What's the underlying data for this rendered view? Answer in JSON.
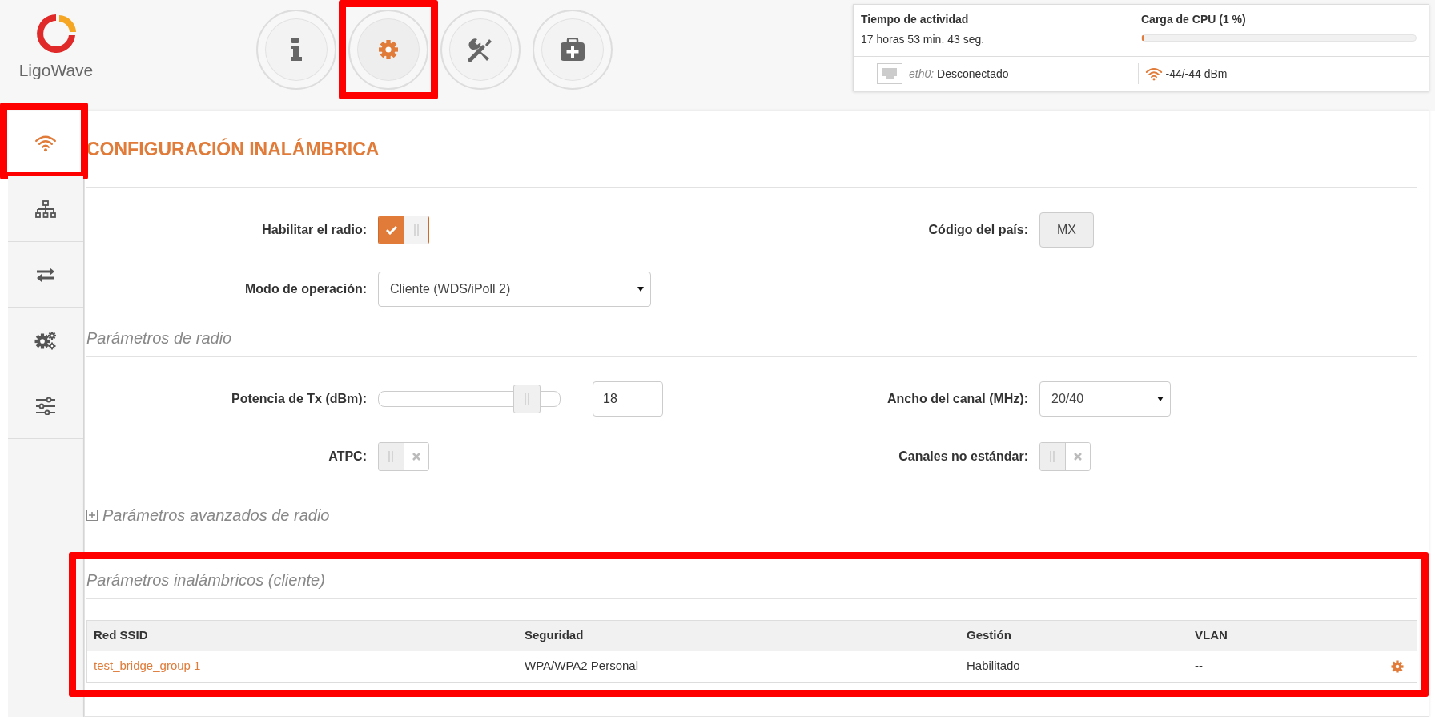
{
  "logo": {
    "text": "LigoWave"
  },
  "nav": [
    {
      "kind": "info",
      "selected": false,
      "highlighted": false
    },
    {
      "kind": "gear",
      "selected": true,
      "highlighted": true
    },
    {
      "kind": "tools",
      "selected": false,
      "highlighted": false
    },
    {
      "kind": "medkit",
      "selected": false,
      "highlighted": false
    }
  ],
  "status": {
    "uptime_label": "Tiempo de actividad",
    "uptime": "17 horas 53 min. 43 seg.",
    "cpu_label": "Carga de CPU (1 %)",
    "cpu_level": {
      "level": 0.01
    },
    "eth_name": "eth0:",
    "eth_status": "Desconectado",
    "signal": "-44/-44 dBm"
  },
  "sidebar": {
    "items": [
      {
        "kind": "wifi",
        "selected": true,
        "highlighted": true
      },
      {
        "kind": "network",
        "selected": false,
        "highlighted": false
      },
      {
        "kind": "arrows",
        "selected": false,
        "highlighted": false
      },
      {
        "kind": "gears",
        "selected": false,
        "highlighted": false
      },
      {
        "kind": "sliders",
        "selected": false,
        "highlighted": false
      }
    ]
  },
  "title": "CONFIGURACIÓN INALÁMBRICA",
  "general": {
    "rows": [
      {
        "left": {
          "kind": "toggle",
          "label": "Habilitar el radio:",
          "on": true
        },
        "right": {
          "kind": "readonly",
          "label": "Código del país:",
          "value": "MX"
        }
      },
      {
        "left": {
          "kind": "select",
          "label": "Modo de operación:",
          "value": "Cliente (WDS/iPoll 2)"
        }
      }
    ]
  },
  "radio_section": {
    "title": "Parámetros de radio",
    "rows": [
      {
        "left": {
          "kind": "slider",
          "label": "Potencia de Tx (dBm):",
          "level": 0.82,
          "value": "18"
        },
        "right": {
          "kind": "select",
          "label": "Ancho del canal (MHz):",
          "value": "20/40"
        }
      },
      {
        "left": {
          "kind": "toggle",
          "label": "ATPC:",
          "on": false
        },
        "right": {
          "kind": "toggle",
          "label": "Canales no estándar:",
          "on": false
        }
      }
    ]
  },
  "advanced": {
    "title": "Parámetros avanzados de radio",
    "expanded": false
  },
  "wireless": {
    "title": "Parámetros inalámbricos (cliente)",
    "highlighted": true,
    "columns": [
      "Red SSID",
      "Seguridad",
      "Gestión",
      "VLAN"
    ],
    "rows": [
      {
        "cells": [
          "test_bridge_group 1",
          "WPA/WPA2 Personal",
          "Habilitado",
          "--"
        ]
      }
    ]
  }
}
